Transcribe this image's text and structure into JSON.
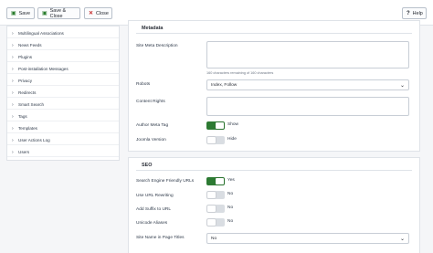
{
  "toolbar": {
    "save": "Save",
    "save_close": "Save & Close",
    "close": "Close",
    "help": "Help"
  },
  "sidebar": {
    "items": [
      {
        "label": "Multilingual Associations"
      },
      {
        "label": "News Feeds"
      },
      {
        "label": "Plugins"
      },
      {
        "label": "Post-installation Messages"
      },
      {
        "label": "Privacy"
      },
      {
        "label": "Redirects"
      },
      {
        "label": "Smart Search"
      },
      {
        "label": "Tags"
      },
      {
        "label": "Templates"
      },
      {
        "label": "User Actions Log"
      },
      {
        "label": "Users"
      }
    ]
  },
  "metadata": {
    "title": "Metadata",
    "meta_description_label": "Site Meta Description",
    "meta_description_value": "",
    "char_hint": "160 characters remaining of 160 characters",
    "robots_label": "Robots",
    "robots_value": "Index, Follow",
    "content_rights_label": "Content Rights",
    "author_tag_label": "Author Meta Tag",
    "author_tag_state": "Show",
    "joomla_version_label": "Joomla Version",
    "joomla_version_state": "Hide"
  },
  "seo": {
    "title": "SEO",
    "sef_label": "Search Engine Friendly URLs",
    "sef_state": "Yes",
    "rewrite_label": "Use URL Rewriting",
    "rewrite_state": "No",
    "suffix_label": "Add Suffix to URL",
    "suffix_state": "No",
    "unicode_label": "Unicode Aliases",
    "unicode_state": "No",
    "sitename_label": "Site Name in Page Titles",
    "sitename_value": "No"
  },
  "colors": {
    "toggle_on": "#2c7a32",
    "toggle_off": "#d9dde2",
    "save_icon": "#2a7d2e",
    "close_icon": "#c52827"
  },
  "icons": [
    "save-icon",
    "save-close-icon",
    "close-icon",
    "help-icon",
    "chevron-right-icon",
    "chevron-down-icon"
  ]
}
